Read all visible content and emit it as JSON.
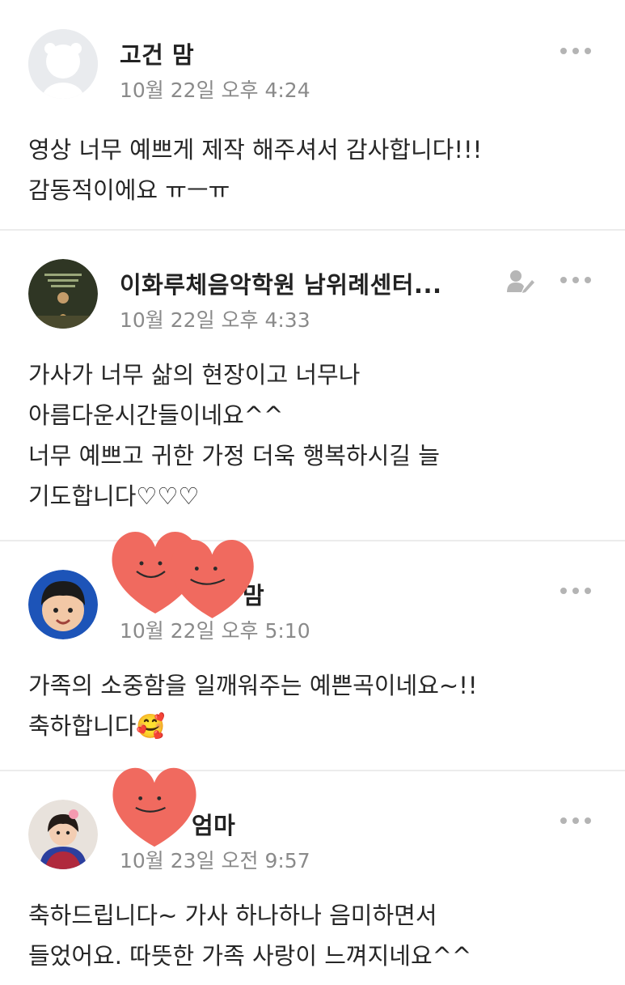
{
  "comments": [
    {
      "author": "고건 맘",
      "time": "10월 22일 오후 4:24",
      "lines": [
        "영상 너무 예쁘게 제작 해주셔서 감사합니다!!!",
        "감동적이에요 ㅠㅡㅠ"
      ]
    },
    {
      "author": "이화루체음악학원 남위례센터...",
      "time": "10월 22일 오후 4:33",
      "lines": [
        "가사가 너무 삶의 현장이고 너무나",
        "아름다운시간들이네요^^",
        "너무 예쁘고 귀한 가정 더욱 행복하시길 늘",
        "기도합니다♡♡♡"
      ]
    },
    {
      "author": "맘",
      "time": "10월 22일 오후 5:10",
      "lines": [
        "가족의 소중함을 일깨워주는 예쁜곡이네요~!!",
        "축하합니다🥰"
      ]
    },
    {
      "author": "엄마",
      "time": "10월 23일 오전 9:57",
      "lines": [
        "축하드립니다~ 가사 하나하나 음미하면서",
        "들었어요. 따뜻한 가족 사랑이 느껴지네요^^"
      ]
    }
  ],
  "colors": {
    "time": "#8a8a8a",
    "divider": "#ececec",
    "more_dots": "#b4b4b4",
    "sticker": "#f06a5f"
  },
  "icons": [
    "default-avatar-icon",
    "more-options-icon",
    "admin-badge-icon",
    "heart-sticker"
  ]
}
